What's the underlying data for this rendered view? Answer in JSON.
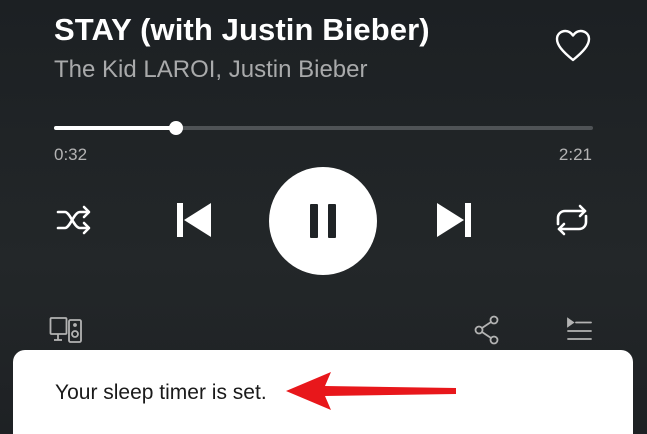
{
  "track": {
    "title": "STAY (with Justin Bieber)",
    "artist": "The Kid LAROI, Justin Bieber",
    "liked": false
  },
  "playback": {
    "elapsed": "0:32",
    "total": "2:21",
    "progress_fraction": 0.227,
    "state": "playing"
  },
  "controls": {
    "icons": [
      "shuffle-icon",
      "previous-icon",
      "pause-icon",
      "next-icon",
      "repeat-icon"
    ]
  },
  "footer_icons": [
    "devices-icon",
    "share-icon",
    "queue-icon"
  ],
  "toast": {
    "message": "Your sleep timer is set."
  },
  "annotation": {
    "arrow_color": "#e8171b"
  },
  "colors": {
    "background": "#1f2326",
    "accent": "#ffffff",
    "secondary_text": "#a9aaab",
    "toast_bg": "#ffffff"
  }
}
